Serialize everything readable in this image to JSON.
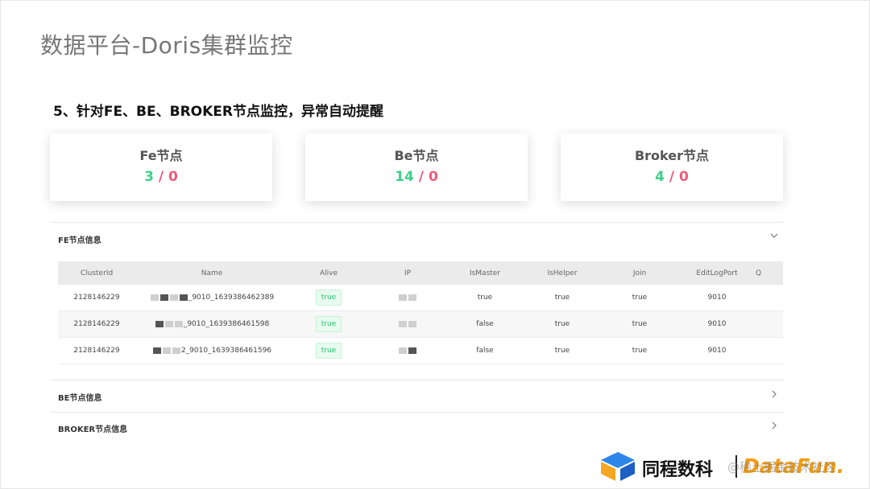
{
  "slide": {
    "title": "数据平台-Doris集群监控",
    "subtitle": "5、针对FE、BE、BROKER节点监控，异常自动提醒"
  },
  "cards": [
    {
      "label": "Fe节点",
      "ok": "3",
      "sep": " / ",
      "bad": "0"
    },
    {
      "label": "Be节点",
      "ok": "14",
      "sep": " / ",
      "bad": "0"
    },
    {
      "label": "Broker节点",
      "ok": "4",
      "sep": " / ",
      "bad": "0"
    }
  ],
  "sections": {
    "fe": {
      "title": "FE节点信息"
    },
    "be": {
      "title": "BE节点信息"
    },
    "broker": {
      "title": "BROKER节点信息"
    }
  },
  "table": {
    "headers": [
      "ClusterId",
      "Name",
      "Alive",
      "IP",
      "IsMaster",
      "IsHelper",
      "Join",
      "EditLogPort",
      "Q"
    ],
    "rows": [
      {
        "cluster_id": "2128146229",
        "name_suffix": "_9010_1639386462389",
        "alive": "true",
        "is_master": "true",
        "is_helper": "true",
        "join": "true",
        "edit_log_port": "9010"
      },
      {
        "cluster_id": "2128146229",
        "name_suffix": "_9010_1639386461598",
        "alive": "true",
        "is_master": "false",
        "is_helper": "true",
        "join": "true",
        "edit_log_port": "9010"
      },
      {
        "cluster_id": "2128146229",
        "name_suffix": "2_9010_1639386461596",
        "alive": "true",
        "is_master": "false",
        "is_helper": "true",
        "join": "true",
        "edit_log_port": "9010"
      }
    ]
  },
  "icons": {
    "expanded": "chevron-down-icon",
    "collapsed": "chevron-right-icon"
  },
  "footer": {
    "brand": "同程数科",
    "watermark": "@稀土掘金技术社区",
    "partner": "DataFun."
  },
  "colors": {
    "ok": "#3fd08a",
    "bad": "#ee5a7a",
    "tag_bg": "#e8fbf0",
    "tag_text": "#27c26c"
  }
}
